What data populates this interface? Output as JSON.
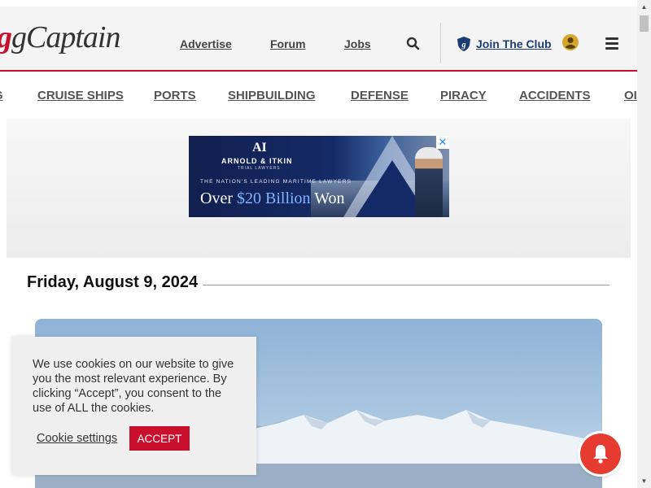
{
  "header": {
    "logo_text": "gCaptain",
    "nav": [
      "Advertise",
      "Forum",
      "Jobs"
    ],
    "club_label": "Join The Club"
  },
  "categories": [
    "G",
    "CRUISE SHIPS",
    "PORTS",
    "SHIPBUILDING",
    "DEFENSE",
    "PIRACY",
    "ACCIDENTS",
    "OI"
  ],
  "ad": {
    "logo": "AI",
    "firm": "ARNOLD & ITKIN",
    "firm_sub": "TRIAL LAWYERS",
    "tagline": "THE NATION'S LEADING MARITIME LAWYERS",
    "headline_pre": "Over",
    "headline_amount": "$20 Billion",
    "headline_post": "Won"
  },
  "date": "Friday, August 9, 2024",
  "cookie": {
    "text": "We use cookies on our website to give you the most relevant experience. By clicking “Accept”, you consent to the use of ALL the cookies.",
    "settings_label": "Cookie settings",
    "accept_label": "ACCEPT"
  },
  "icons": {
    "search": "search-icon",
    "club": "shield-icon",
    "user": "user-icon",
    "menu": "hamburger-icon",
    "bell": "bell-icon",
    "adchoices": "close-icon"
  },
  "colors": {
    "brand_red": "#c8102e",
    "club_blue": "#1b3d73",
    "bell_red": "#e53b30",
    "user_gold": "#d4a62a"
  }
}
